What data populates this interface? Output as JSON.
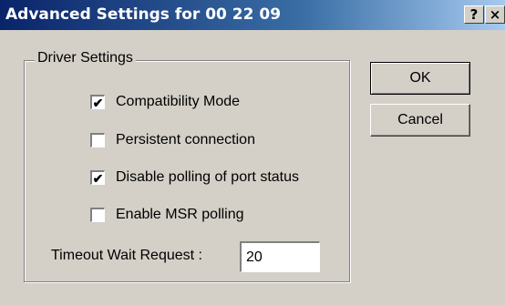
{
  "window": {
    "title": "Advanced Settings for 00 22 09",
    "help_label": "?",
    "close_label": "×"
  },
  "driver_settings": {
    "group_label": "Driver Settings",
    "options": [
      {
        "label": "Compatibility Mode",
        "checked": true,
        "mark": "✔"
      },
      {
        "label": "Persistent connection",
        "checked": false,
        "mark": ""
      },
      {
        "label": "Disable polling of port status",
        "checked": true,
        "mark": "✔"
      },
      {
        "label": "Enable MSR polling",
        "checked": false,
        "mark": ""
      }
    ],
    "timeout": {
      "label": "Timeout Wait Request :",
      "value": "20"
    }
  },
  "buttons": {
    "ok_label": "OK",
    "cancel_label": "Cancel"
  },
  "colors": {
    "title_start": "#0a246a",
    "title_end": "#a6caf0",
    "face": "#d4d0c8"
  }
}
